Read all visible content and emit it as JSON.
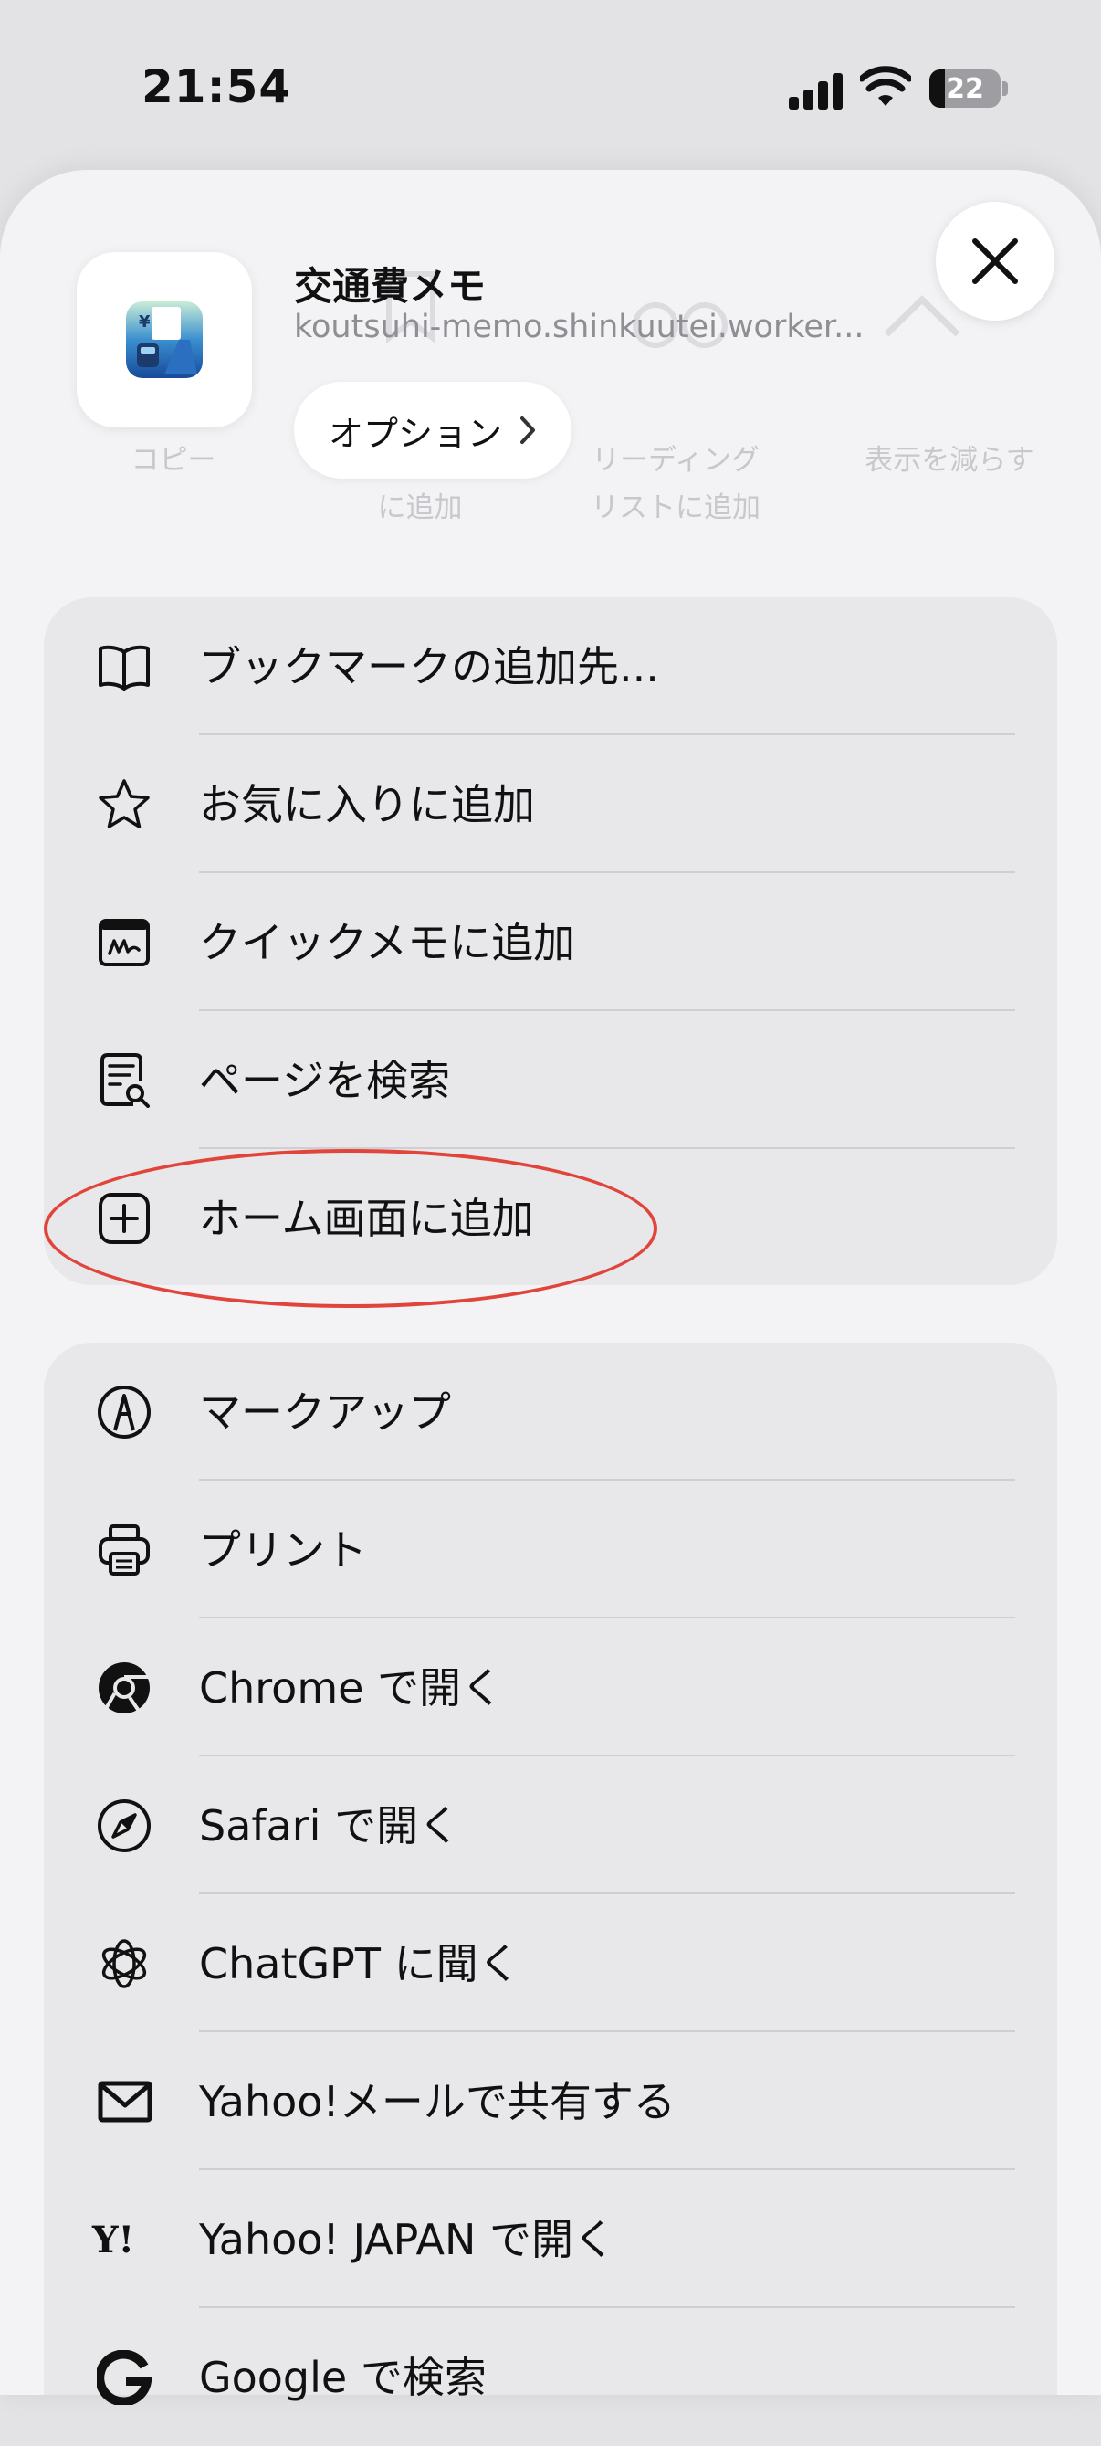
{
  "status_bar": {
    "time": "21:54",
    "battery": "22",
    "battery_fraction": 0.22
  },
  "header": {
    "app_title": "交通費メモ",
    "url": "koutsuhi-memo.shinkuutei.worker...",
    "options_label": "オプション"
  },
  "ghost_actions": {
    "copy": "コピー",
    "bookmark_line2": "に追加",
    "reading_list_line1": "リーディング",
    "reading_list_line2": "リストに追加",
    "show_less": "表示を減らす"
  },
  "group1": {
    "items": [
      {
        "label": "ブックマークの追加先...",
        "icon": "book-icon"
      },
      {
        "label": "お気に入りに追加",
        "icon": "star-icon"
      },
      {
        "label": "クイックメモに追加",
        "icon": "quick-note-icon"
      },
      {
        "label": "ページを検索",
        "icon": "find-on-page-icon"
      },
      {
        "label": "ホーム画面に追加",
        "icon": "add-square-icon"
      }
    ]
  },
  "group2": {
    "items": [
      {
        "label": "マークアップ",
        "icon": "markup-icon"
      },
      {
        "label": "プリント",
        "icon": "printer-icon"
      },
      {
        "label": "Chrome で開く",
        "icon": "chrome-icon"
      },
      {
        "label": "Safari で開く",
        "icon": "compass-icon"
      },
      {
        "label": "ChatGPT に聞く",
        "icon": "chatgpt-icon"
      },
      {
        "label": "Yahoo!メールで共有する",
        "icon": "mail-icon"
      },
      {
        "label": "Yahoo! JAPAN で開く",
        "icon": "yahoo-icon"
      },
      {
        "label": "Google で検索",
        "icon": "google-icon"
      }
    ]
  },
  "colors": {
    "sheet": "#f3f3f5",
    "group": "#e8e8ea",
    "highlight": "#e0443a"
  }
}
